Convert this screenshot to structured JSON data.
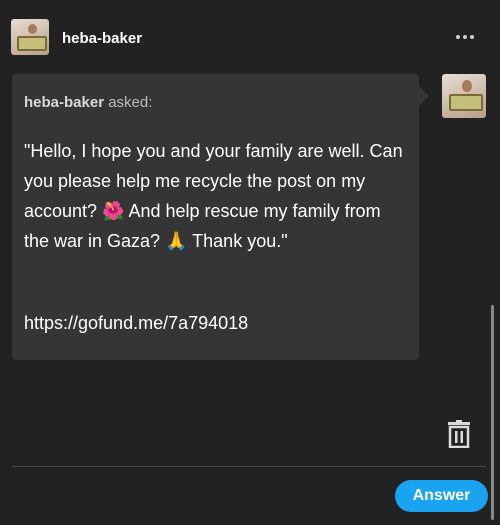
{
  "header": {
    "username": "heba-baker",
    "more_icon": "ellipsis-icon"
  },
  "ask": {
    "asker": "heba-baker",
    "asked_label": "asked:",
    "question": "\"Hello, I hope you and your family are well. Can you please help me recycle the post on my account? 🌺 And help rescue my family from the war in Gaza? 🙏 Thank you.\"",
    "link": "https://gofund.me/7a794018"
  },
  "actions": {
    "delete_icon": "trash-icon",
    "answer_label": "Answer"
  },
  "colors": {
    "background": "#222222",
    "bubble": "#353535",
    "accent": "#1aa3f0"
  }
}
